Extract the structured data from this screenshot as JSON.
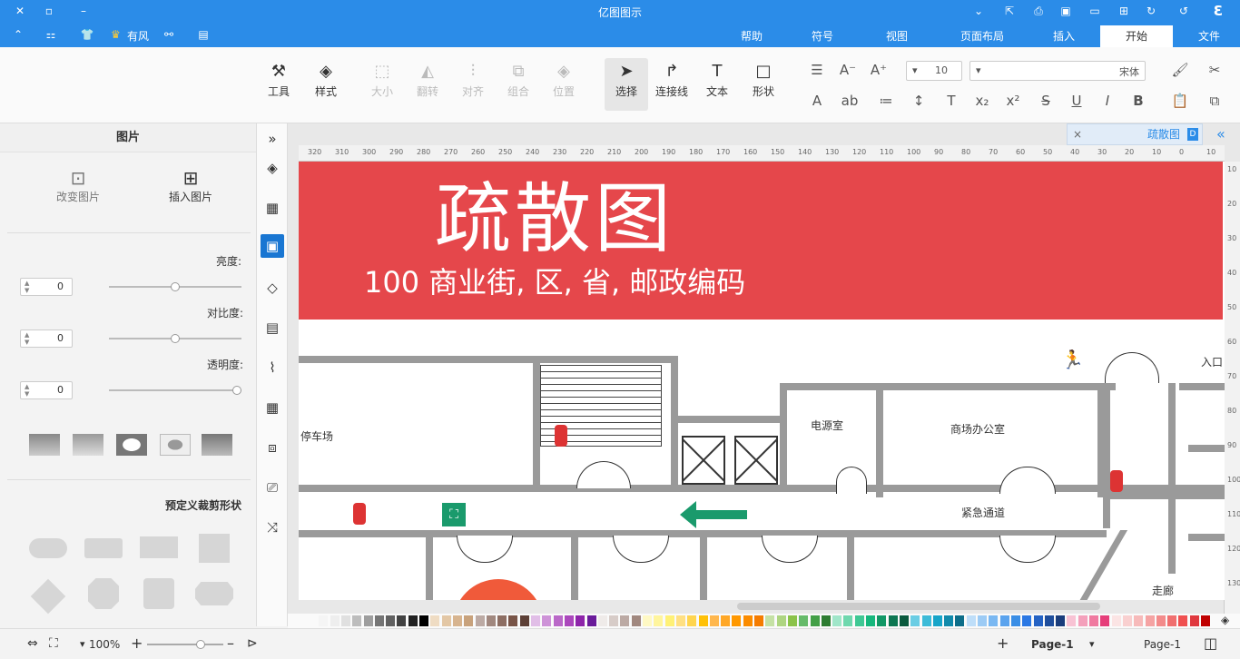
{
  "app": {
    "title": "亿图图示"
  },
  "menu": {
    "file": "文件",
    "start": "开始",
    "insert": "插入",
    "page_layout": "页面布局",
    "view": "视图",
    "symbol": "符号",
    "help": "帮助",
    "brand": "有风"
  },
  "ribbon": {
    "font_name": "宋体",
    "font_size": "10",
    "shape": "形状",
    "text": "文本",
    "connector": "连接线",
    "select": "选择",
    "position": "位置",
    "group": "组合",
    "align": "对齐",
    "flip": "翻转",
    "size": "大小",
    "style": "样式",
    "tools": "工具"
  },
  "panel": {
    "title": "图片",
    "insert_image": "插入图片",
    "change_image": "改变图片",
    "brightness": "亮度:",
    "contrast": "对比度:",
    "transparency": "透明度:",
    "brightness_val": "0",
    "contrast_val": "0",
    "transparency_val": "0",
    "preset_shapes": "预定义裁剪形状"
  },
  "doc": {
    "tab": "疏散图",
    "close": "×"
  },
  "diagram": {
    "title": "疏散图",
    "address": "100 商业街, 区, 省, 邮政编码",
    "parking": "停车场",
    "power_room": "电源室",
    "mall_office": "商场办公室",
    "emergency_passage": "紧急通道",
    "corridor": "走廊",
    "entrance": "入口"
  },
  "ruler": {
    "h": [
      "10",
      "0",
      "10",
      "20",
      "30",
      "40",
      "50",
      "60",
      "70",
      "80",
      "90",
      "100",
      "110",
      "120",
      "130",
      "140",
      "150",
      "160",
      "170",
      "180",
      "190",
      "200",
      "210",
      "220",
      "230",
      "240",
      "250",
      "260",
      "270",
      "280",
      "290",
      "300",
      "310",
      "320"
    ],
    "v": [
      "10",
      "20",
      "30",
      "40",
      "50",
      "60",
      "70",
      "80",
      "90",
      "100",
      "110",
      "120",
      "130"
    ]
  },
  "status": {
    "page_select": "Page-1",
    "page_tab": "Page-1",
    "add": "+",
    "zoom": "100%"
  },
  "colors": {
    "accent": "#2b8ce8",
    "banner": "#e5474b",
    "arrow": "#1a9a6c"
  },
  "palette": [
    "#c00000",
    "#e0383e",
    "#f05050",
    "#f06f6f",
    "#f38b8b",
    "#f5a3a3",
    "#f7baba",
    "#f9d0d0",
    "#fbe4e4",
    "#e63e7a",
    "#f07aa0",
    "#f4a0bb",
    "#f8c3d4",
    "#1a3d7c",
    "#1f4e9c",
    "#2563c4",
    "#2b78e4",
    "#3a8ee6",
    "#5aa3ee",
    "#7ab8f2",
    "#9ccbf5",
    "#bedef9",
    "#0d6e8a",
    "#118aab",
    "#17a5c9",
    "#3dbbd8",
    "#6acde4",
    "#0a5a3e",
    "#0d7752",
    "#119866",
    "#15b77c",
    "#3fc894",
    "#6fd8ae",
    "#a0e6c9",
    "#2e7d32",
    "#43a047",
    "#66bb6a",
    "#8bc34a",
    "#aed581",
    "#c5e1a5",
    "#f57c00",
    "#fb8c00",
    "#ff9800",
    "#ffa726",
    "#ffb74d",
    "#ffc107",
    "#ffd54f",
    "#ffe082",
    "#fff176",
    "#fff59d",
    "#fff9c4",
    "#a1887f",
    "#bcaaa4",
    "#d7ccc8",
    "#efebe9",
    "#6a1b9a",
    "#8e24aa",
    "#ab47bc",
    "#ba68c8",
    "#ce93d8",
    "#e1bee7",
    "#5d4037",
    "#795548",
    "#8d6e63",
    "#a1887f",
    "#bcaaa4",
    "#c8a27c",
    "#d7b48f",
    "#e3c7a5",
    "#efdcc3",
    "#000000",
    "#212121",
    "#424242",
    "#616161",
    "#757575",
    "#9e9e9e",
    "#bdbdbd",
    "#e0e0e0",
    "#eeeeee",
    "#f5f5f5"
  ]
}
